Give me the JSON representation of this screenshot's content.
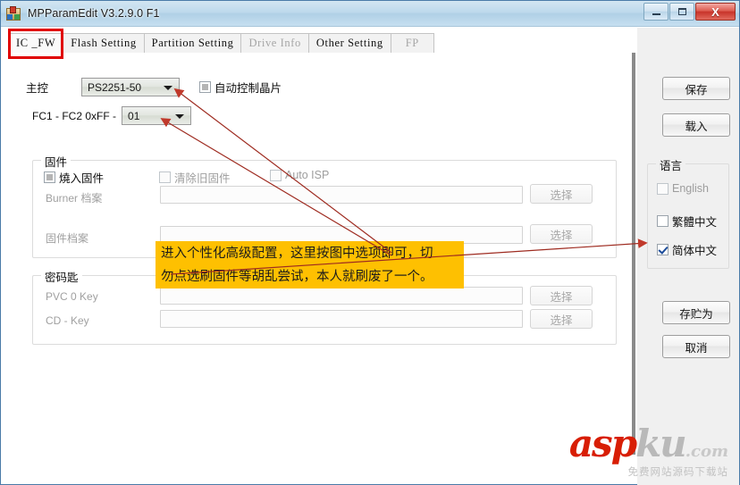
{
  "window": {
    "title": "MPParamEdit V3.2.9.0 F1",
    "icon": "app-icon",
    "controls": {
      "minimize": "–",
      "maximize": "□",
      "close": "X"
    }
  },
  "tabs": [
    {
      "label": "IC _FW",
      "selected": true,
      "disabled": false
    },
    {
      "label": "Flash Setting",
      "selected": false,
      "disabled": false
    },
    {
      "label": "Partition Setting",
      "selected": false,
      "disabled": false
    },
    {
      "label": "Drive Info",
      "selected": false,
      "disabled": true
    },
    {
      "label": "Other Setting",
      "selected": false,
      "disabled": false
    },
    {
      "label": "FP",
      "selected": false,
      "disabled": true
    }
  ],
  "main": {
    "mcu_label": "主控",
    "mcu_value": "PS2251-50",
    "auto_chip_label": "自动控制晶片",
    "fc_prefix": "FC1 - FC2  0xFF -",
    "fc_value": "01",
    "firmware": {
      "legend": "固件",
      "burn_fw_label": "燒入固件",
      "clear_old_fw_label": "清除旧固件",
      "auto_isp_label": "Auto ISP",
      "burner_file_label": "Burner 档案",
      "burner_file_value": "",
      "fw_file_label": "固件档案",
      "fw_file_value": "",
      "select_label": "选择"
    },
    "keys": {
      "legend": "密码匙",
      "pvc_label": "PVC 0 Key",
      "pvc_value": "",
      "cd_label": "CD - Key",
      "cd_value": "",
      "select_label": "选择"
    }
  },
  "sidebar": {
    "save_label": "保存",
    "load_label": "载入",
    "language": {
      "legend": "语言",
      "options": [
        {
          "label": "English",
          "checked": false
        },
        {
          "label": "繁體中文",
          "checked": false
        },
        {
          "label": "简体中文",
          "checked": true
        }
      ]
    },
    "save_as_label": "存贮为",
    "cancel_label": "取消"
  },
  "annotation": {
    "line1": "进入个性化高级配置，这里按图中选项即可，切",
    "line2": "勿点选刷固件等胡乱尝试，本人就刷废了一个。",
    "highlight_color": "#fec001",
    "arrow_color": "#b01b12",
    "tab_box_color": "#e00000"
  },
  "watermark": {
    "asp": "asp",
    "ku": "ku",
    "com": ".com",
    "subtitle": "免费网站源码下载站"
  }
}
